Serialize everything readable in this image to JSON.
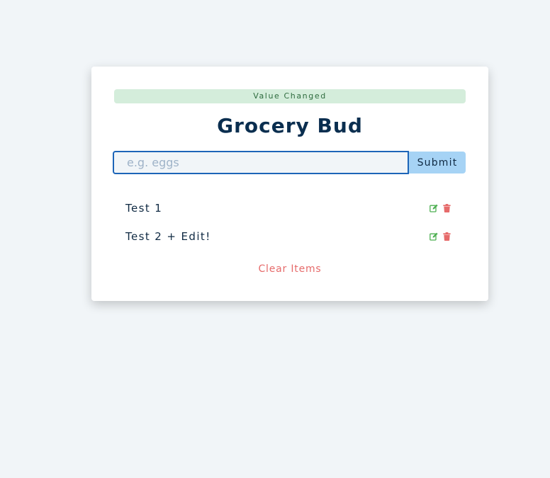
{
  "alert": {
    "text": "Value Changed",
    "color": "#d4eddb"
  },
  "app": {
    "title": "Grocery Bud"
  },
  "form": {
    "placeholder": "e.g. eggs",
    "value": "",
    "submit_label": "Submit"
  },
  "items": [
    {
      "title": "Test 1"
    },
    {
      "title": "Test 2 + Edit!"
    }
  ],
  "actions": {
    "clear_label": "Clear Items"
  },
  "icons": {
    "edit": "edit-icon",
    "delete": "trash-icon"
  },
  "colors": {
    "edit": "#4caf50",
    "delete": "#e66b6b",
    "accent": "#1d65b8",
    "submit": "#a6d3f5"
  }
}
